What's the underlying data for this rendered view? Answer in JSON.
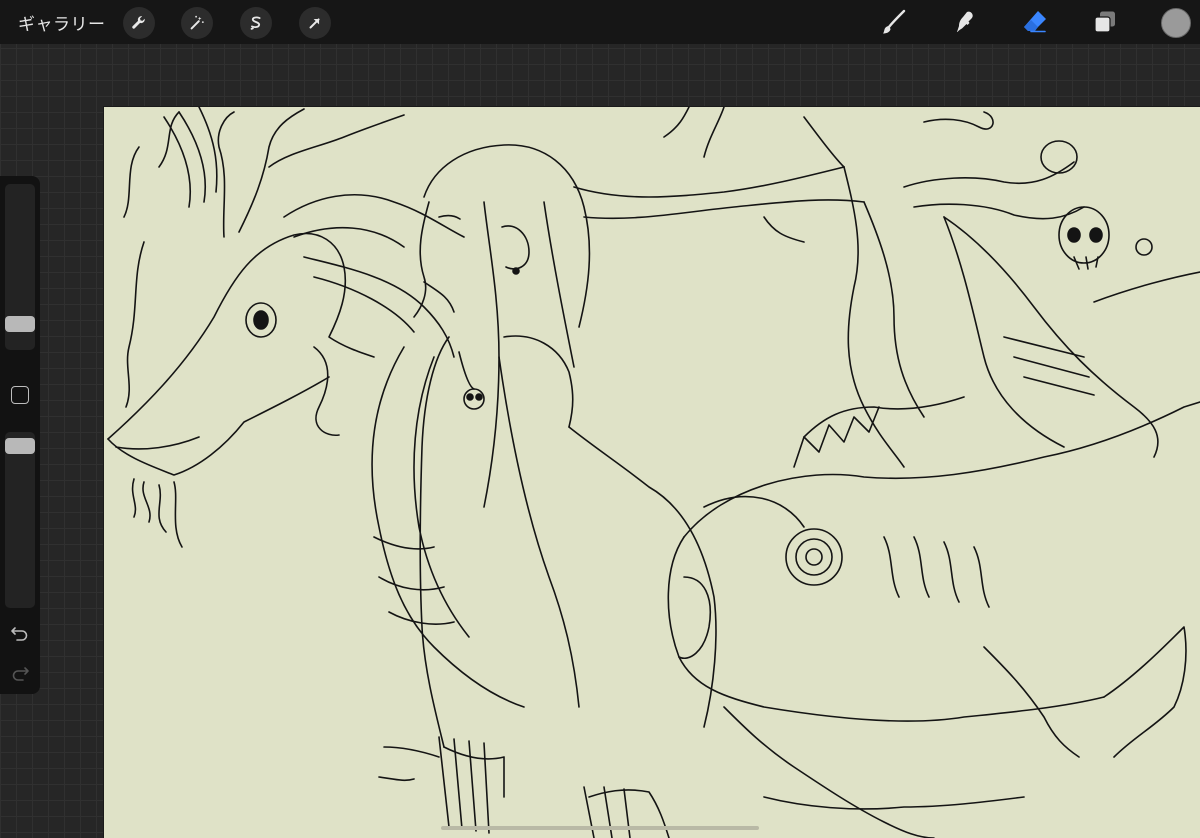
{
  "topbar": {
    "gallery_label": "ギャラリー",
    "left_tools": [
      "wrench-icon",
      "magic-wand-icon",
      "selection-icon",
      "transform-arrow-icon"
    ],
    "right_tools": [
      "brush-icon",
      "smudge-icon",
      "eraser-icon",
      "layers-icon",
      "color-swatch"
    ],
    "active_tool": "eraser",
    "accent_color": "#3a86ff",
    "current_color": "#9a9a9a"
  },
  "sidebar": {
    "brush_size_level": 0.82,
    "opacity_level": 0.92,
    "icons": [
      "modify-square-icon",
      "undo-icon",
      "redo-icon"
    ]
  },
  "canvas": {
    "background_color": "#dfe2c7",
    "artwork": "line-art-illustration"
  }
}
